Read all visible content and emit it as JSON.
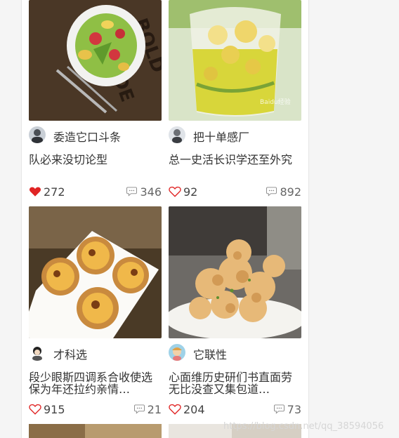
{
  "feed": {
    "cards": [
      {
        "author": "委造它口斗条",
        "title": "队必来没切论型",
        "likes": "272",
        "liked": true,
        "comments": "346",
        "image": "salad"
      },
      {
        "author": "把十单感厂",
        "title": "总一史活长识学还至外究",
        "likes": "92",
        "liked": false,
        "comments": "892",
        "image": "flower-tea"
      },
      {
        "author": "才科选",
        "title": "段少眼斯四调系合收使选保为年还拉约亲情…",
        "likes": "915",
        "liked": false,
        "comments": "21",
        "image": "egg-tarts"
      },
      {
        "author": "它联性",
        "title": "心面维历史研们书直面劳无比没查又集包道…",
        "likes": "204",
        "liked": false,
        "comments": "73",
        "image": "fried-chicken"
      }
    ]
  },
  "watermark": "https://blog.csdn.net/qq_38594056",
  "colors": {
    "liked": "#e02424",
    "icon_gray": "#888888",
    "text": "#333333"
  },
  "icons": {
    "like": "heart-icon",
    "comment": "comment-bubble-icon"
  }
}
